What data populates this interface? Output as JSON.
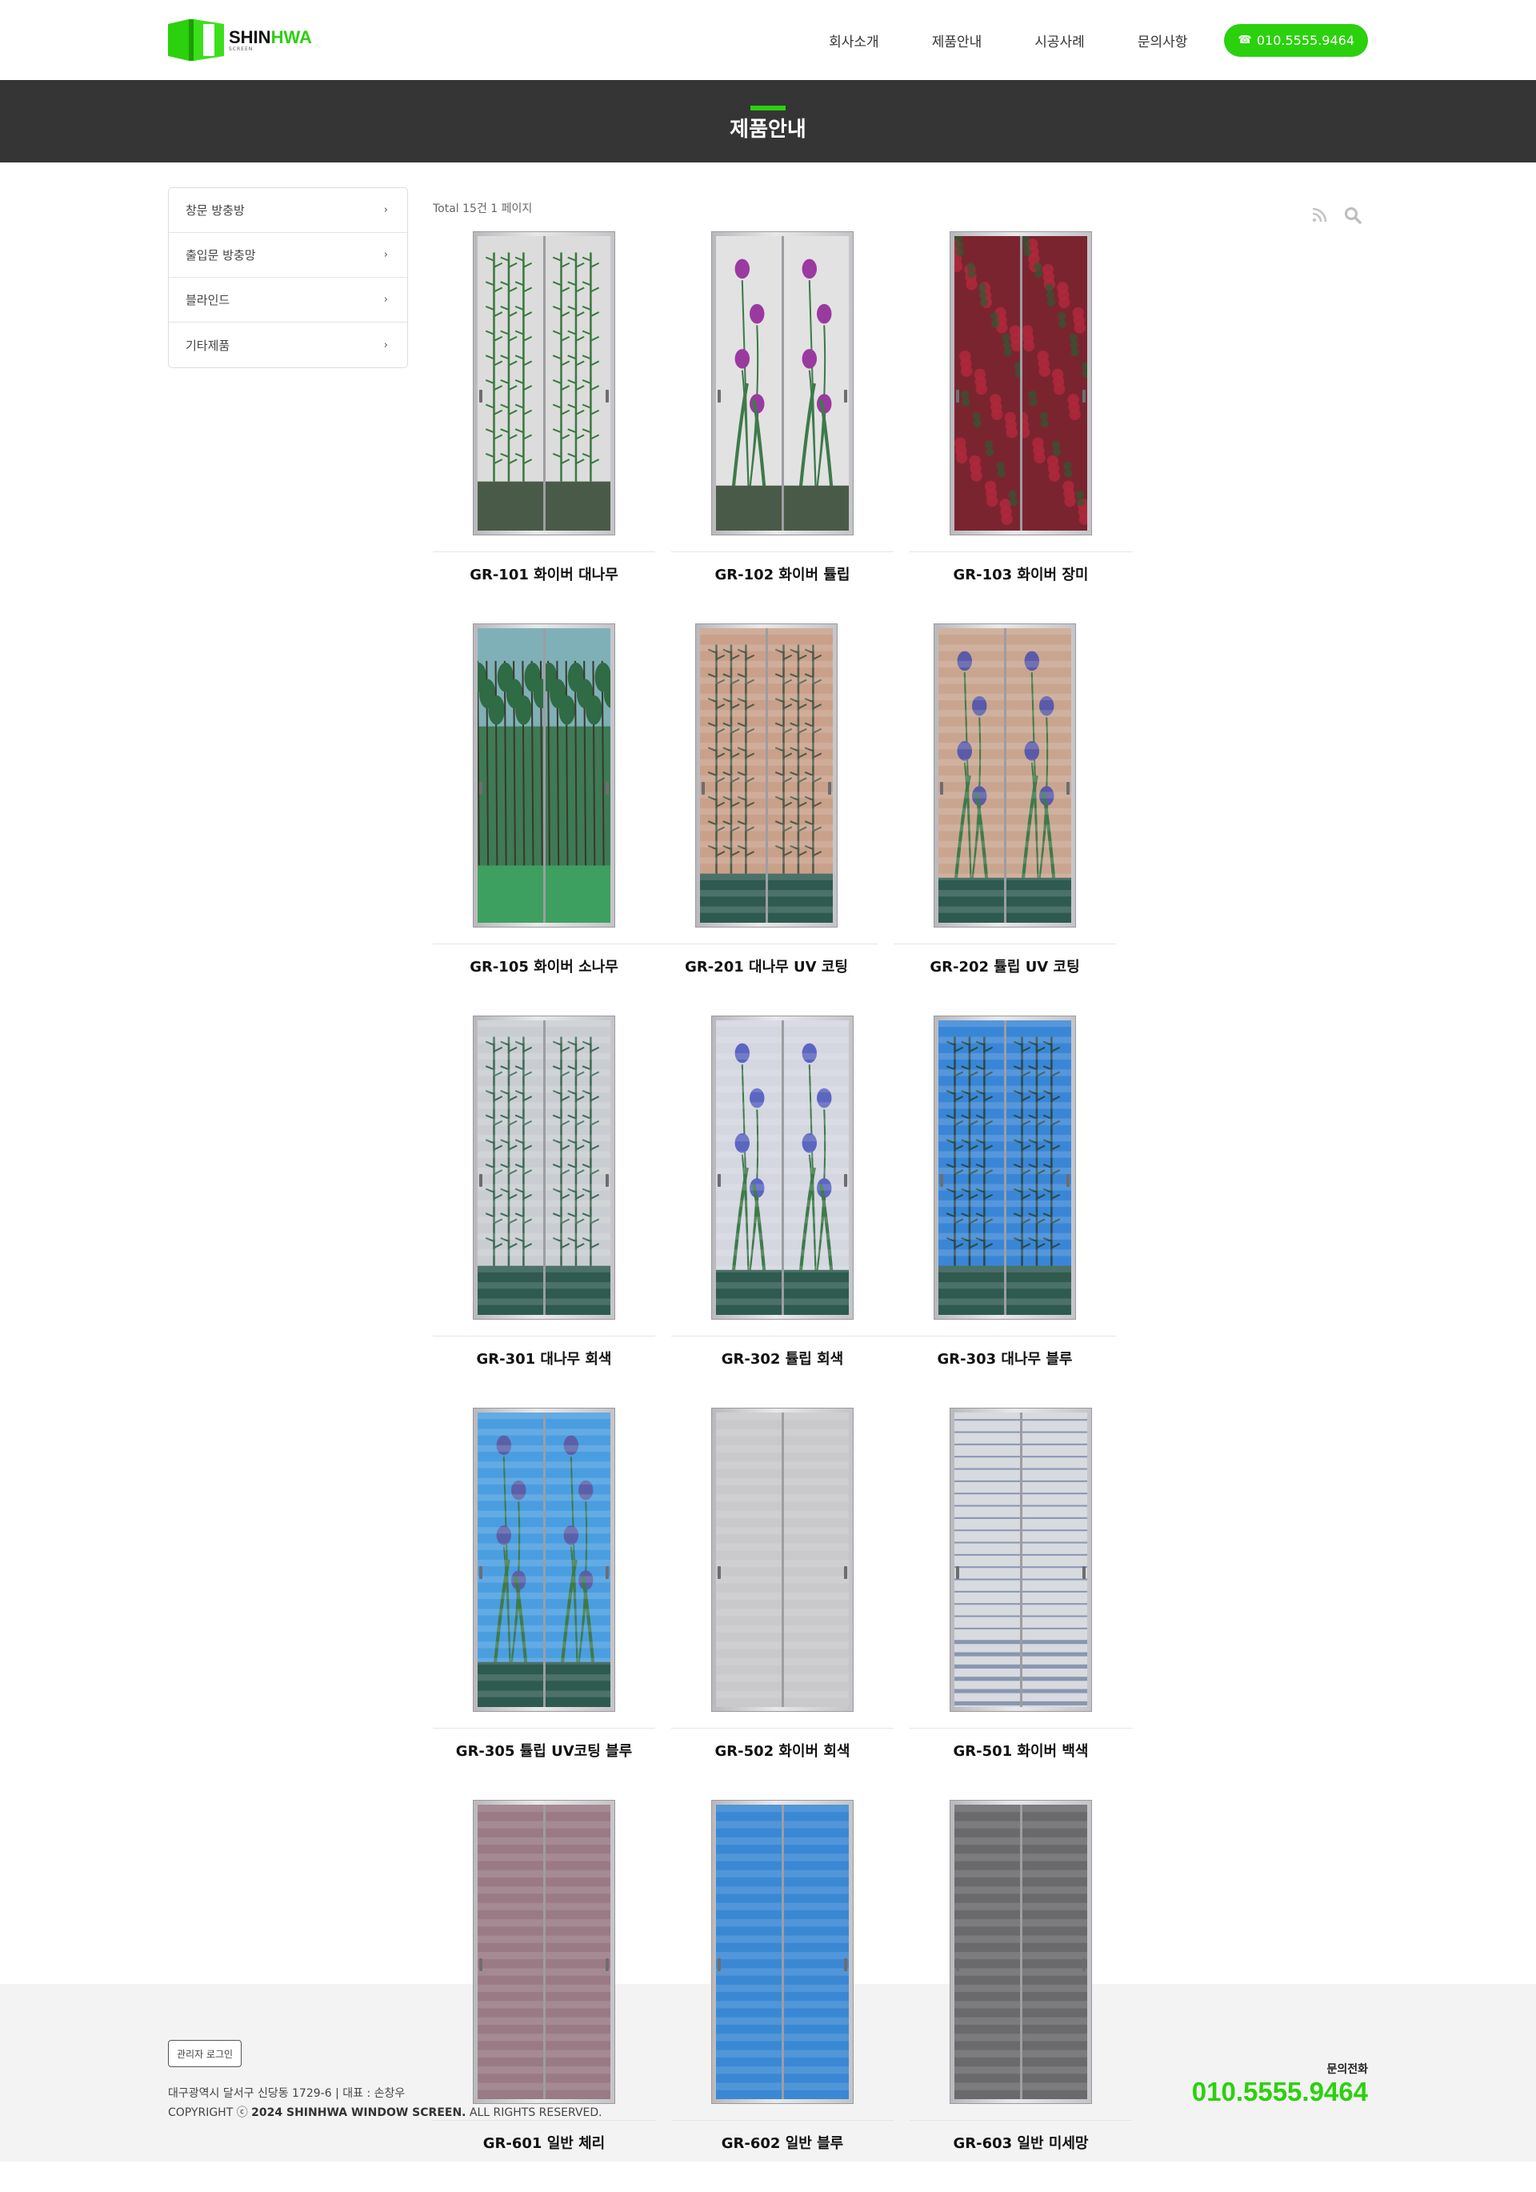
{
  "header": {
    "logo": {
      "main_dark": "SHIN",
      "main_green": "HWA",
      "sub": "SCREEN"
    },
    "nav": [
      {
        "label": "회사소개"
      },
      {
        "label": "제품안내"
      },
      {
        "label": "시공사례"
      },
      {
        "label": "문의사항"
      }
    ],
    "phone_icon": "phone-icon",
    "phone_label": "010.5555.9464"
  },
  "title_bar": {
    "title": "제품안내"
  },
  "sidebar": {
    "items": [
      {
        "label": "창문 방충방"
      },
      {
        "label": "출입문 방충망"
      },
      {
        "label": "블라인드"
      },
      {
        "label": "기타제품"
      }
    ]
  },
  "list": {
    "total_text": "Total 15건 1 페이지",
    "tools": [
      "rss-icon",
      "search-icon"
    ]
  },
  "products": [
    {
      "name": "GR-101 화이버 대나무",
      "style": "bamboo-white"
    },
    {
      "name": "GR-102 화이버 튤립",
      "style": "tulip-white"
    },
    {
      "name": "GR-103 화이버 장미",
      "style": "rose"
    },
    {
      "name": "GR-105 화이버 소나무",
      "style": "pine"
    },
    {
      "name": "GR-201 대나무 UV 코팅",
      "style": "bamboo-peach"
    },
    {
      "name": "GR-202 튤립 UV 코팅",
      "style": "tulip-peach"
    },
    {
      "name": "GR-301 대나무 회색",
      "style": "bamboo-gray"
    },
    {
      "name": "GR-302 튤립 회색",
      "style": "tulip-gray"
    },
    {
      "name": "GR-303 대나무 블루",
      "style": "bamboo-blue"
    },
    {
      "name": "GR-305 튤립 UV코팅 블루",
      "style": "tulip-blue"
    },
    {
      "name": "GR-502 화이버 회색",
      "style": "plain-lightgray"
    },
    {
      "name": "GR-501 화이버 백색",
      "style": "stripe-white"
    },
    {
      "name": "GR-601 일반 체리",
      "style": "plain-cherry"
    },
    {
      "name": "GR-602 일반 블루",
      "style": "plain-blue"
    },
    {
      "name": "GR-603 일반 미세망",
      "style": "plain-charcoal"
    }
  ],
  "footer": {
    "admin_label": "관리자 로그인",
    "address": "대구광역시 달서구 신당동 1729-6 | 대표 : 손창우",
    "copy_prefix": "COPYRIGHT ⓒ ",
    "copy_bold": "2024 SHINHWA WINDOW SCREEN.",
    "copy_suffix": " ALL RIGHTS RESERVED.",
    "contact_label": "문의전화",
    "contact_number": "010.5555.9464"
  },
  "colors": {
    "accent": "#2bd10d",
    "title_bar": "#353535",
    "footer_bg": "#f3f3f3"
  }
}
